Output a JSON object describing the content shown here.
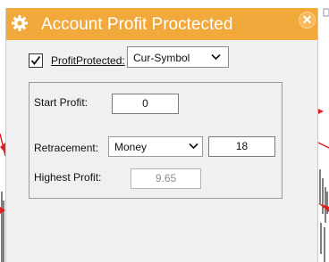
{
  "window": {
    "title": "Account Profit Proctected",
    "title_icon": "gear-icon",
    "close_icon": "close-icon",
    "close_glyph": "✕"
  },
  "protection": {
    "label": "ProfitProtected:",
    "checked": true,
    "symbol_mode": "Cur-Symbol"
  },
  "fields": {
    "start_profit_label": "Start Profit:",
    "start_profit_value": "0",
    "retracement_label": "Retracement:",
    "retracement_mode": "Money",
    "retracement_value": "18",
    "highest_profit_label": "Highest Profit:",
    "highest_profit_value": "9.65"
  },
  "colors": {
    "titlebar": "#f2a93b",
    "dialog_bg": "#f0f0f0",
    "chart_red": "#e02020"
  }
}
